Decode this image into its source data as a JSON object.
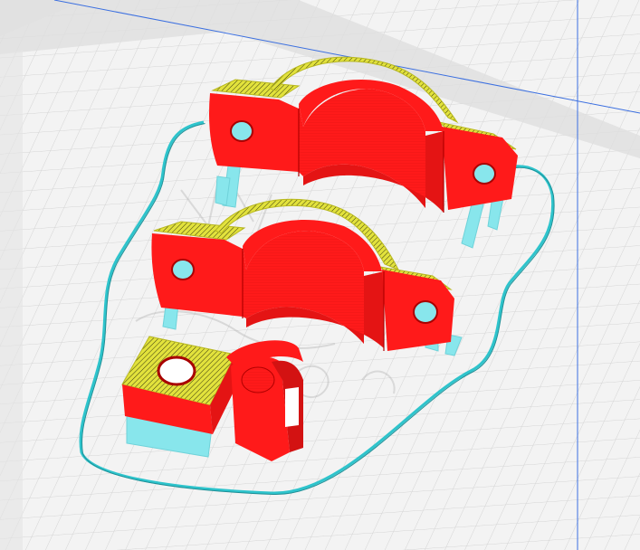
{
  "viewport": {
    "name": "3d-slice-preview",
    "build_plate_color": "#f2f2f2",
    "grid_color": "#d4d4d4",
    "border_color": "#bdbdbd",
    "volume_line_color": "#3b6fe0"
  },
  "legend": {
    "wall_color": "#ff1a1a",
    "wall_shade_color": "#d31212",
    "infill_color": "#e0e040",
    "support_color": "#88e6ec",
    "skirt_color": "#2ec4cc"
  },
  "models": [
    {
      "id": "clamp-top",
      "kind": "pipe-clamp"
    },
    {
      "id": "clamp-middle",
      "kind": "pipe-clamp"
    },
    {
      "id": "hook-bracket",
      "kind": "bracket"
    }
  ]
}
